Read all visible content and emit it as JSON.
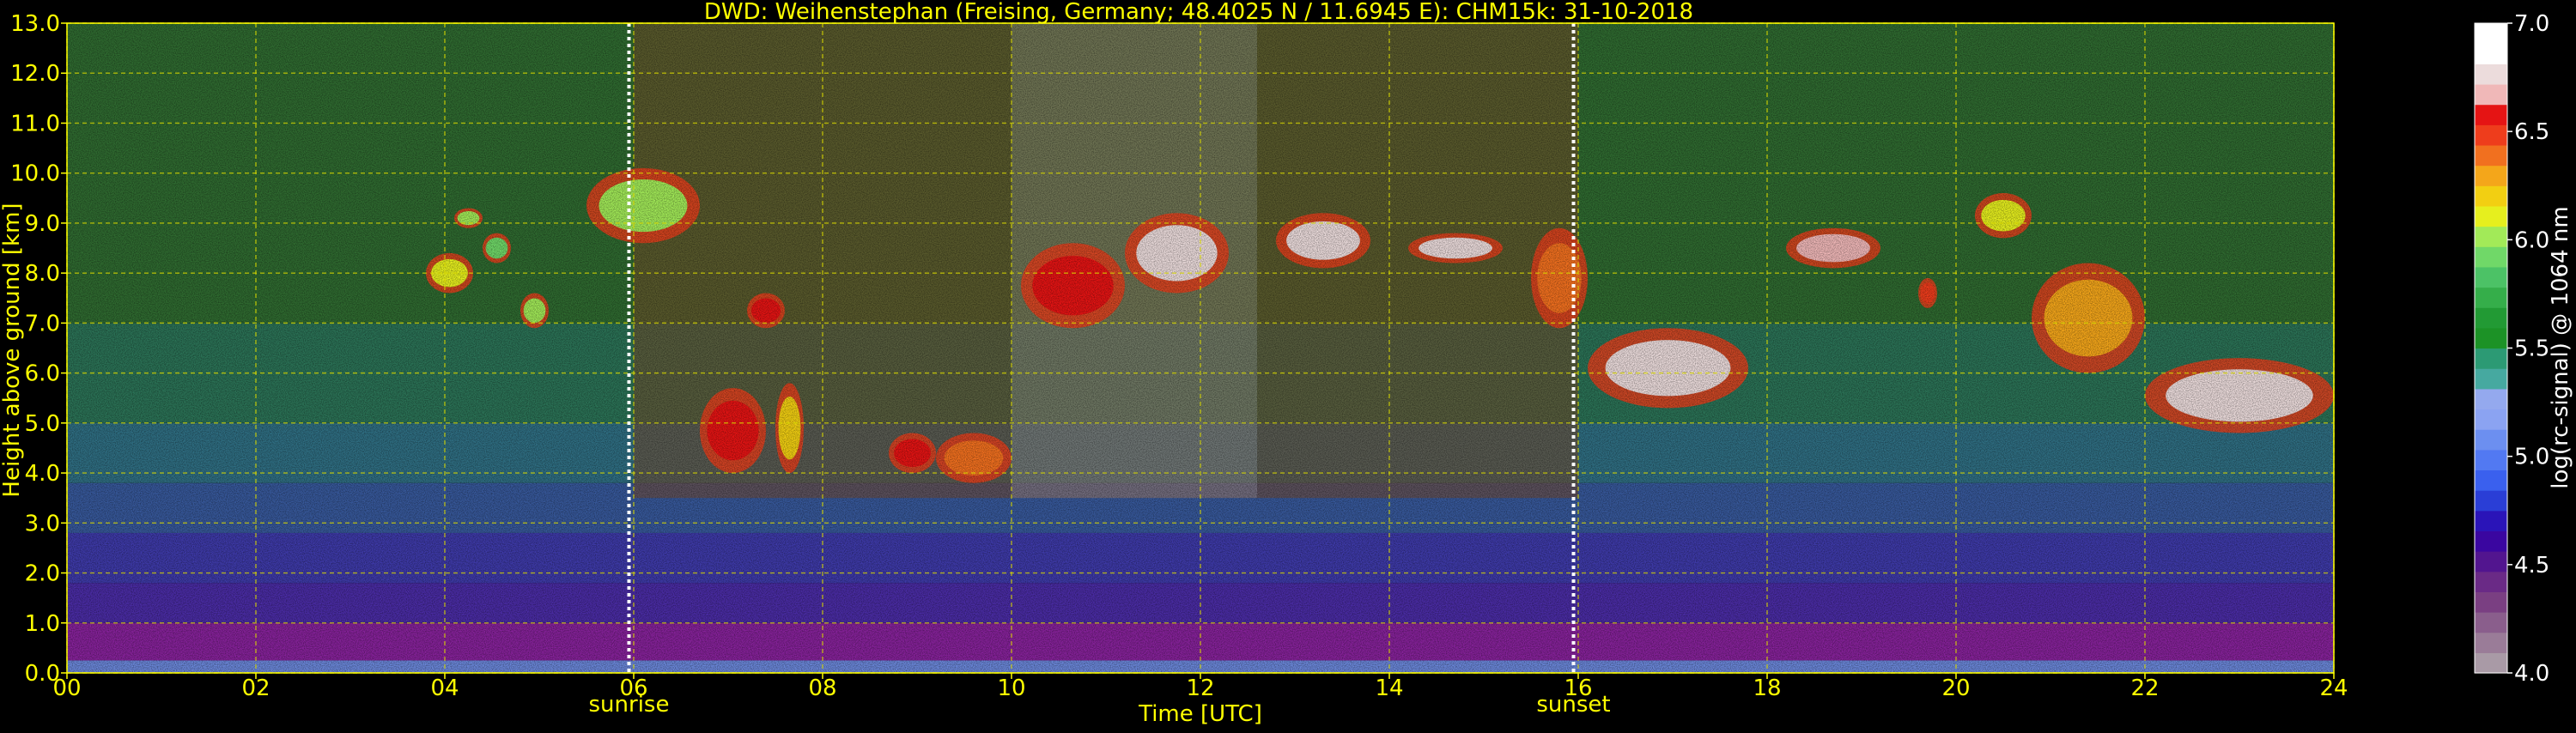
{
  "chart_data": {
    "type": "heatmap",
    "title": "DWD: Weihenstephan (Freising, Germany; 48.4025 N / 11.6945 E):    CHM15k: 31-10-2018",
    "xlabel": "Time [UTC]",
    "ylabel": "Height above ground [km]",
    "xlim": [
      0,
      24
    ],
    "ylim": [
      0,
      13
    ],
    "x_ticks": [
      "00",
      "02",
      "04",
      "06",
      "08",
      "10",
      "12",
      "14",
      "16",
      "18",
      "20",
      "22",
      "24"
    ],
    "y_ticks": [
      "0.0",
      "1.0",
      "2.0",
      "3.0",
      "4.0",
      "5.0",
      "6.0",
      "7.0",
      "8.0",
      "9.0",
      "10.0",
      "11.0",
      "12.0",
      "13.0"
    ],
    "grid": true,
    "markers": [
      {
        "label": "sunrise",
        "time": 5.95
      },
      {
        "label": "sunset",
        "time": 15.95
      }
    ],
    "colorbar": {
      "label": "log(rc-signal) @ 1064 nm",
      "range": [
        4.0,
        7.0
      ],
      "ticks": [
        "4.0",
        "4.5",
        "5.0",
        "5.5",
        "6.0",
        "6.5",
        "7.0"
      ],
      "colors": [
        "#a99aa6",
        "#9a7c98",
        "#8a5e8c",
        "#7a3f82",
        "#6a2a86",
        "#52158f",
        "#3a06a0",
        "#2a14b8",
        "#2a3ed6",
        "#3a60ee",
        "#5279f2",
        "#6c8ff0",
        "#8ba3f2",
        "#94a9ee",
        "#46a9a0",
        "#2c9a74",
        "#1c9226",
        "#229a34",
        "#35ae4a",
        "#4cc266",
        "#70d868",
        "#a2ea58",
        "#e6ef1e",
        "#f2cf12",
        "#f4a61a",
        "#f1701f",
        "#ee3d1c",
        "#e51414",
        "#f0b8b8",
        "#ecdcdc",
        "#ffffff",
        "#ffffff"
      ]
    },
    "background_layers": [
      {
        "h0": 0.0,
        "h1": 0.25,
        "color": "#6a86d8"
      },
      {
        "h0": 0.25,
        "h1": 1.0,
        "color": "#86229a"
      },
      {
        "h0": 1.0,
        "h1": 1.8,
        "color": "#4a2ca4"
      },
      {
        "h0": 1.8,
        "h1": 2.8,
        "color": "#3e3aa8"
      },
      {
        "h0": 2.8,
        "h1": 3.8,
        "color": "#37589a"
      },
      {
        "h0": 3.8,
        "h1": 5.0,
        "color": "#2f6e82"
      },
      {
        "h0": 5.0,
        "h1": 7.0,
        "color": "#2b7256"
      },
      {
        "h0": 7.0,
        "h1": 13.0,
        "color": "#2f6a30"
      }
    ],
    "daylight_overlay": [
      {
        "t0": 6.0,
        "t1": 10.0,
        "color": "#7a4a2a",
        "opacity": 0.55
      },
      {
        "t0": 10.0,
        "t1": 12.6,
        "color": "#9a7a6a",
        "opacity": 0.6
      },
      {
        "t0": 12.6,
        "t1": 16.0,
        "color": "#7a4a2a",
        "opacity": 0.55
      }
    ],
    "cloud_layers": [
      {
        "t0": 3.8,
        "t1": 4.3,
        "h0": 7.6,
        "h1": 8.4,
        "level": 6.1
      },
      {
        "t0": 4.1,
        "t1": 4.4,
        "h0": 8.9,
        "h1": 9.3,
        "level": 6.0
      },
      {
        "t0": 4.4,
        "t1": 4.7,
        "h0": 8.2,
        "h1": 8.8,
        "level": 5.9
      },
      {
        "t0": 4.8,
        "t1": 5.1,
        "h0": 6.9,
        "h1": 7.6,
        "level": 6.0
      },
      {
        "t0": 5.5,
        "t1": 6.7,
        "h0": 8.6,
        "h1": 10.1,
        "level": 6.0
      },
      {
        "t0": 7.2,
        "t1": 7.6,
        "h0": 6.9,
        "h1": 7.6,
        "level": 6.6
      },
      {
        "t0": 6.7,
        "t1": 7.4,
        "h0": 4.0,
        "h1": 5.7,
        "level": 6.6
      },
      {
        "t0": 7.5,
        "t1": 7.8,
        "h0": 4.0,
        "h1": 5.8,
        "level": 6.2
      },
      {
        "t0": 8.7,
        "t1": 9.2,
        "h0": 4.0,
        "h1": 4.8,
        "level": 6.6
      },
      {
        "t0": 9.2,
        "t1": 10.0,
        "h0": 3.8,
        "h1": 4.8,
        "level": 6.4
      },
      {
        "t0": 10.1,
        "t1": 11.2,
        "h0": 6.9,
        "h1": 8.6,
        "level": 6.6
      },
      {
        "t0": 11.2,
        "t1": 12.3,
        "h0": 7.6,
        "h1": 9.2,
        "level": 6.8
      },
      {
        "t0": 12.8,
        "t1": 13.8,
        "h0": 8.1,
        "h1": 9.2,
        "level": 6.8
      },
      {
        "t0": 14.2,
        "t1": 15.2,
        "h0": 8.2,
        "h1": 8.8,
        "level": 6.8
      },
      {
        "t0": 15.5,
        "t1": 16.1,
        "h0": 6.9,
        "h1": 8.9,
        "level": 6.4
      },
      {
        "t0": 16.1,
        "t1": 17.8,
        "h0": 5.3,
        "h1": 6.9,
        "level": 6.8
      },
      {
        "t0": 18.2,
        "t1": 19.2,
        "h0": 8.1,
        "h1": 8.9,
        "level": 6.7
      },
      {
        "t0": 19.6,
        "t1": 19.8,
        "h0": 7.3,
        "h1": 7.9,
        "level": 6.5
      },
      {
        "t0": 20.2,
        "t1": 20.8,
        "h0": 8.7,
        "h1": 9.6,
        "level": 6.1
      },
      {
        "t0": 20.8,
        "t1": 22.0,
        "h0": 6.0,
        "h1": 8.2,
        "level": 6.3
      },
      {
        "t0": 22.0,
        "t1": 24.0,
        "h0": 4.8,
        "h1": 6.3,
        "level": 6.8
      }
    ]
  }
}
